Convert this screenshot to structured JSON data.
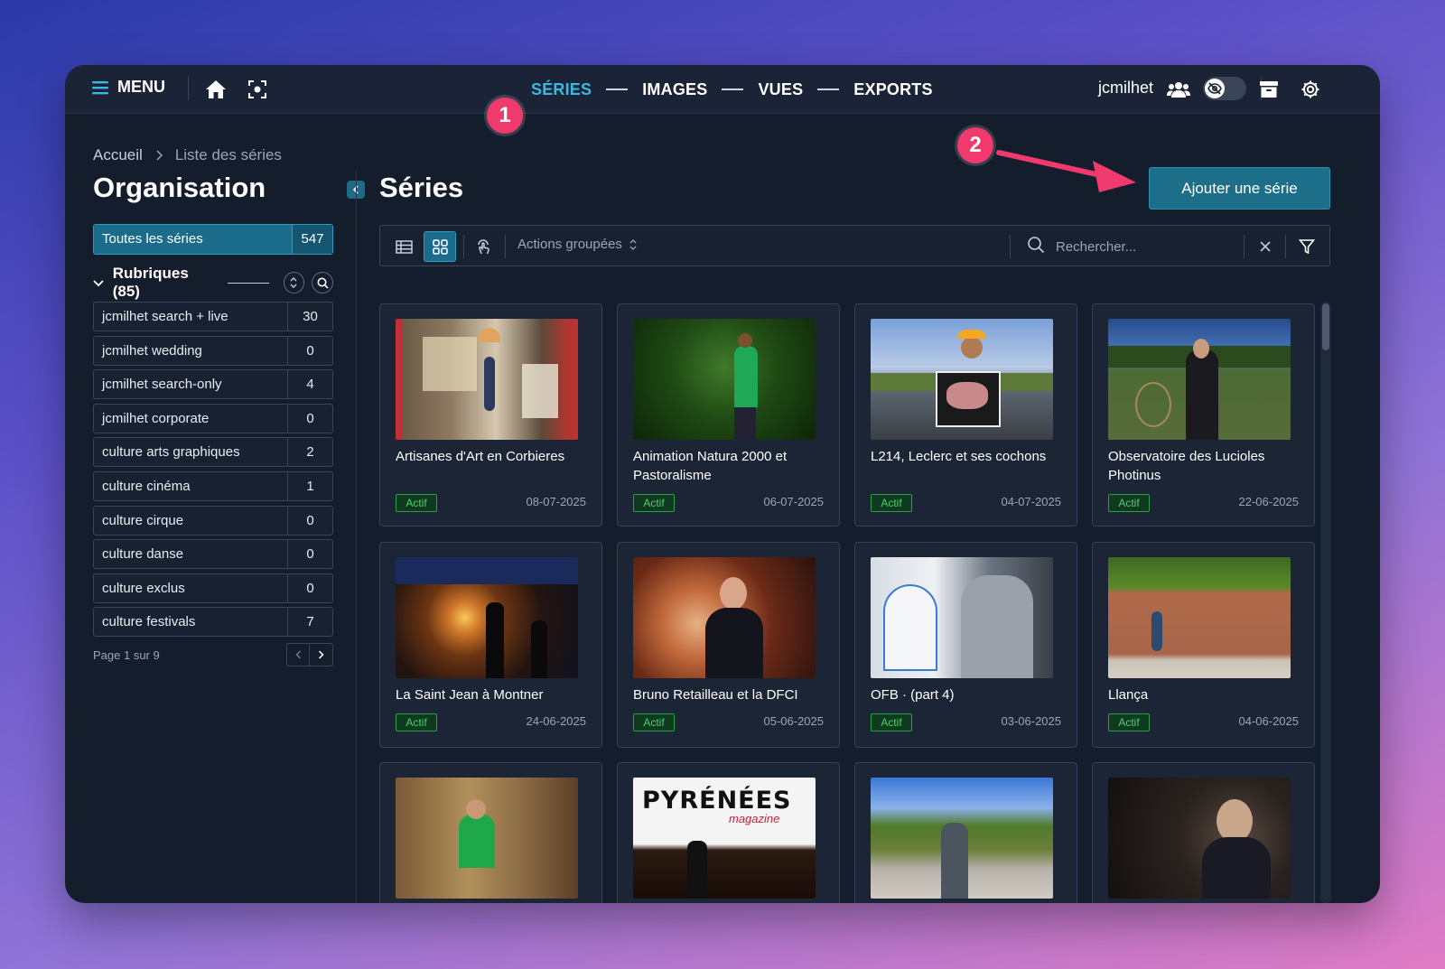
{
  "topbar": {
    "menu_label": "MENU",
    "nav": [
      "SÉRIES",
      "IMAGES",
      "VUES",
      "EXPORTS"
    ],
    "active_nav": "SÉRIES",
    "user_name": "jcmilhet"
  },
  "annotations": {
    "step1": "1",
    "step2": "2"
  },
  "breadcrumb": {
    "home": "Accueil",
    "current": "Liste des séries"
  },
  "sidebar": {
    "title": "Organisation",
    "all_series": {
      "label": "Toutes les séries",
      "count": "547"
    },
    "rubriques_title": "Rubriques (85)",
    "items": [
      {
        "label": "jcmilhet search + live",
        "count": "30"
      },
      {
        "label": "jcmilhet wedding",
        "count": "0"
      },
      {
        "label": "jcmilhet search-only",
        "count": "4"
      },
      {
        "label": "jcmilhet corporate",
        "count": "0"
      },
      {
        "label": "culture arts graphiques",
        "count": "2"
      },
      {
        "label": "culture cinéma",
        "count": "1"
      },
      {
        "label": "culture cirque",
        "count": "0"
      },
      {
        "label": "culture danse",
        "count": "0"
      },
      {
        "label": "culture exclus",
        "count": "0"
      },
      {
        "label": "culture festivals",
        "count": "7"
      }
    ],
    "pager_text": "Page 1 sur 9"
  },
  "main": {
    "title": "Séries",
    "add_button": "Ajouter une série",
    "actions_label": "Actions groupées",
    "search_placeholder": "Rechercher..."
  },
  "cards": [
    {
      "title": "Artisanes d'Art en Corbieres",
      "status": "Actif",
      "date": "08-07-2025"
    },
    {
      "title": "Animation Natura 2000 et Pastoralisme",
      "status": "Actif",
      "date": "06-07-2025"
    },
    {
      "title": "L214, Leclerc et ses cochons",
      "status": "Actif",
      "date": "04-07-2025"
    },
    {
      "title": "Observatoire des Lucioles Photinus",
      "status": "Actif",
      "date": "22-06-2025"
    },
    {
      "title": "La Saint Jean à Montner",
      "status": "Actif",
      "date": "24-06-2025"
    },
    {
      "title": "Bruno Retailleau et la DFCI",
      "status": "Actif",
      "date": "05-06-2025"
    },
    {
      "title": "OFB · (part 4)",
      "status": "Actif",
      "date": "03-06-2025"
    },
    {
      "title": "Llança",
      "status": "Actif",
      "date": "04-06-2025"
    },
    {
      "title": "",
      "status": "",
      "date": ""
    },
    {
      "title": "",
      "status": "",
      "date": ""
    },
    {
      "title": "",
      "status": "",
      "date": ""
    },
    {
      "title": "",
      "status": "",
      "date": ""
    }
  ],
  "thumb_text": {
    "pyrenees": "PYRÉNÉES",
    "magazine": "magazine"
  },
  "colors": {
    "accent": "#3bb8e0",
    "button": "#1d6e89",
    "annotation": "#f03a6e",
    "status_green": "#4cd06a"
  }
}
